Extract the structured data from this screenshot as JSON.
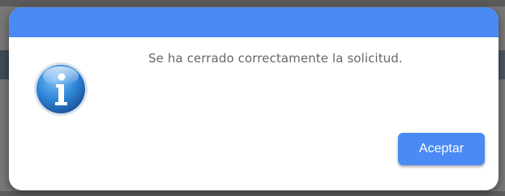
{
  "dialog": {
    "icon": "info-icon",
    "message": "Se ha cerrado correctamente la solicitud.",
    "accept_label": "Aceptar"
  },
  "colors": {
    "header": "#4a8af4",
    "button": "#4a8af4",
    "message_text": "#666666",
    "overlay": "#777777"
  }
}
